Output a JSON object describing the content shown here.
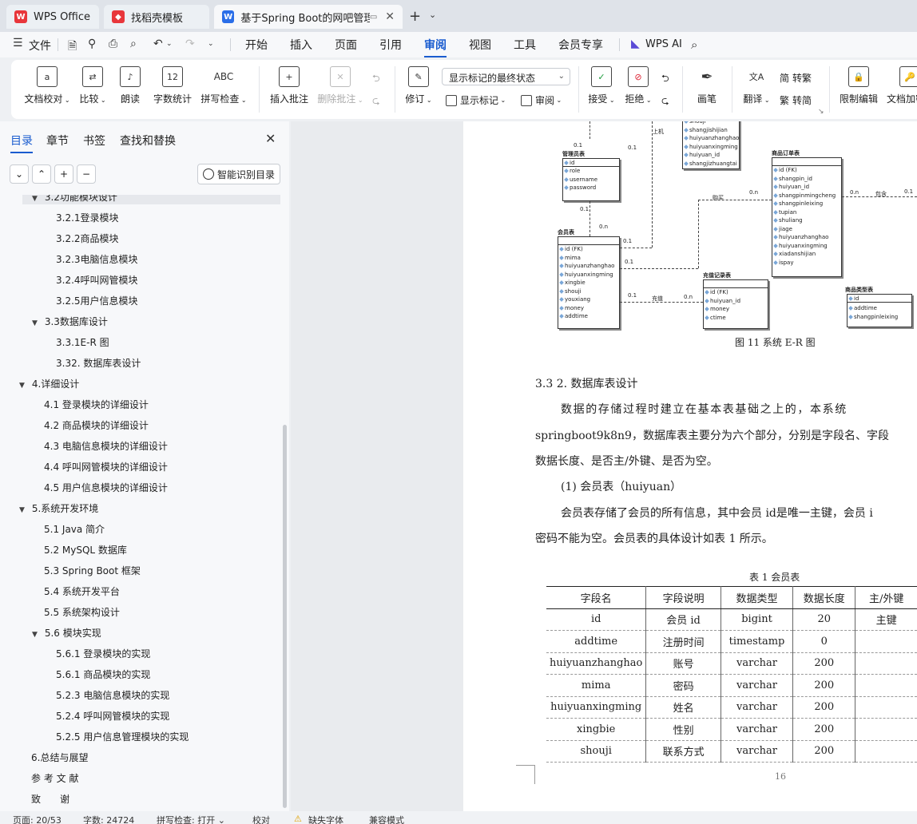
{
  "tabs": {
    "home": "WPS Office",
    "templates": "找稻壳模板",
    "document": "基于Spring Boot的网吧管理系统"
  },
  "menubar": {
    "file": "文件",
    "items": [
      "开始",
      "插入",
      "页面",
      "引用",
      "审阅",
      "视图",
      "工具",
      "会员专享"
    ],
    "active": "审阅",
    "ai": "WPS AI"
  },
  "ribbon": {
    "doc_proofread": "文档校对",
    "compare": "比较",
    "read_aloud": "朗读",
    "word_count": "字数统计",
    "spell_check": "拼写检查",
    "insert_comment": "插入批注",
    "delete_comment": "删除批注",
    "revise": "修订",
    "markup_mode": "显示标记的最终状态",
    "show_markup": "显示标记",
    "review": "审阅",
    "accept": "接受",
    "reject": "拒绝",
    "ink": "画笔",
    "translate": "翻译",
    "to_traditional": "转繁",
    "to_simplified": "转简",
    "restrict_edit": "限制编辑",
    "doc_encrypt": "文档加密",
    "word_count_icon_text": "12",
    "spell_icon_text": "ABC"
  },
  "sidebar": {
    "tabs": [
      "目录",
      "章节",
      "书签",
      "查找和替换"
    ],
    "active_tab": "目录",
    "smart_toc": "智能识别目录",
    "toc": [
      {
        "label": "3.2功能模块设计",
        "level": 2,
        "expanded": true
      },
      {
        "label": "3.2.1登录模块",
        "level": 3
      },
      {
        "label": "3.2.2商品模块",
        "level": 3
      },
      {
        "label": "3.2.3电脑信息模块",
        "level": 3
      },
      {
        "label": "3.2.4呼叫网管模块",
        "level": 3
      },
      {
        "label": "3.2.5用户信息模块",
        "level": 3
      },
      {
        "label": "3.3数据库设计",
        "level": 2,
        "expanded": true
      },
      {
        "label": "3.3.1E-R 图",
        "level": 3
      },
      {
        "label": "3.32. 数据库表设计",
        "level": 3
      },
      {
        "label": "4.详细设计",
        "level": 1,
        "expanded": true
      },
      {
        "label": "4.1 登录模块的详细设计",
        "level": 2
      },
      {
        "label": "4.2 商品模块的详细设计",
        "level": 2
      },
      {
        "label": "4.3 电脑信息模块的详细设计",
        "level": 2
      },
      {
        "label": "4.4 呼叫网管模块的详细设计",
        "level": 2
      },
      {
        "label": "4.5 用户信息模块的详细设计",
        "level": 2
      },
      {
        "label": "5.系统开发环境",
        "level": 1,
        "expanded": true
      },
      {
        "label": "5.1 Java 简介",
        "level": 2
      },
      {
        "label": "5.2 MySQL 数据库",
        "level": 2
      },
      {
        "label": "5.3 Spring Boot 框架",
        "level": 2
      },
      {
        "label": "5.4 系统开发平台",
        "level": 2
      },
      {
        "label": "5.5 系统架构设计",
        "level": 2
      },
      {
        "label": "5.6 模块实现",
        "level": 2,
        "expanded": true
      },
      {
        "label": "5.6.1 登录模块的实现",
        "level": 3
      },
      {
        "label": "5.6.1 商品模块的实现",
        "level": 3
      },
      {
        "label": "5.2.3 电脑信息模块的实现",
        "level": 3
      },
      {
        "label": "5.2.4 呼叫网管模块的实现",
        "level": 3
      },
      {
        "label": "5.2.5 用户信息管理模块的实现",
        "level": 3
      },
      {
        "label": "6.总结与展望",
        "level": 1
      },
      {
        "label": "参 考 文 献",
        "level": 1
      },
      {
        "label": "致　　谢",
        "level": 1
      }
    ]
  },
  "document": {
    "er": {
      "admin_title": "管理员表",
      "admin_fields": [
        "id",
        "role",
        "username",
        "password"
      ],
      "member_title": "会员表",
      "member_fields": [
        "id (FK)",
        "mima",
        "huiyuanzhanghao",
        "huiyuanxingming",
        "xingbie",
        "shouji",
        "youxiang",
        "money",
        "addtime"
      ],
      "computer_fields": [
        "shouji",
        "shangjishijian",
        "huiyuanzhanghao",
        "huiyuanxingming",
        "huiyuan_id",
        "shangjizhuangtai"
      ],
      "order_title": "商品订单表",
      "order_fields": [
        "id (FK)",
        "shangpin_id",
        "huiyuan_id",
        "shangpinmingcheng",
        "shangpinleixing",
        "tupian",
        "shuliang",
        "jiage",
        "huiyuanzhanghao",
        "huiyuanxingming",
        "xiadanshijian",
        "ispay"
      ],
      "recharge_title": "充值记录表",
      "recharge_fields": [
        "id (FK)",
        "huiyuan_id",
        "money",
        "ctime"
      ],
      "ptype_title": "商品类型表",
      "ptype_fields": [
        "id",
        "addtime",
        "shangpinleixing"
      ],
      "labels": {
        "upper": "上机",
        "buy": "购买",
        "contain": "包含",
        "charge": "充值",
        "c01a": "0.1",
        "c01b": "0.1",
        "c01c": "0.1",
        "c0n": "0.n",
        "c01d": "0.1",
        "c01e": "0.1",
        "c0n2": "0.n",
        "c0n3": "0.n",
        "c01f": "0.1",
        "c01g": "0.1",
        "c0n4": "0.n"
      },
      "caption": "图 11 系统 E-R 图"
    },
    "heading": "3.3 2.  数据库表设计",
    "para1_line1": "数据的存储过程时建立在基本表基础之上的，本系统",
    "para1_line2": "springboot9k8n9，数据库表主要分为六个部分，分别是字段名、字段",
    "para1_line3": "数据长度、是否主/外键、是否为空。",
    "item1": "(1) 会员表（huiyuan）",
    "para2_line1": "会员表存储了会员的所有信息，其中会员 id是唯一主键，会员 i",
    "para2_line2": "密码不能为空。会员表的具体设计如表 1 所示。",
    "table_caption": "表 1  会员表",
    "table": {
      "headers": [
        "字段名",
        "字段说明",
        "数据类型",
        "数据长度",
        "主/外键"
      ],
      "rows": [
        [
          "id",
          "会员 id",
          "bigint",
          "20",
          "主键"
        ],
        [
          "addtime",
          "注册时间",
          "timestamp",
          "0",
          ""
        ],
        [
          "huiyuanzhanghao",
          "账号",
          "varchar",
          "200",
          ""
        ],
        [
          "mima",
          "密码",
          "varchar",
          "200",
          ""
        ],
        [
          "huiyuanxingming",
          "姓名",
          "varchar",
          "200",
          ""
        ],
        [
          "xingbie",
          "性别",
          "varchar",
          "200",
          ""
        ],
        [
          "shouji",
          "联系方式",
          "varchar",
          "200",
          ""
        ]
      ]
    },
    "page_number": "16"
  },
  "statusbar": {
    "page": "页面: 20/53",
    "words": "字数: 24724",
    "spell": "拼写检查: 打开",
    "proof": "校对",
    "missing_font": "缺失字体",
    "compat": "兼容模式"
  },
  "colors": {
    "accent": "#1a5ccf",
    "wps_red": "#e8363b",
    "template_red": "#e8363b",
    "doc_blue": "#2a6ee8"
  }
}
